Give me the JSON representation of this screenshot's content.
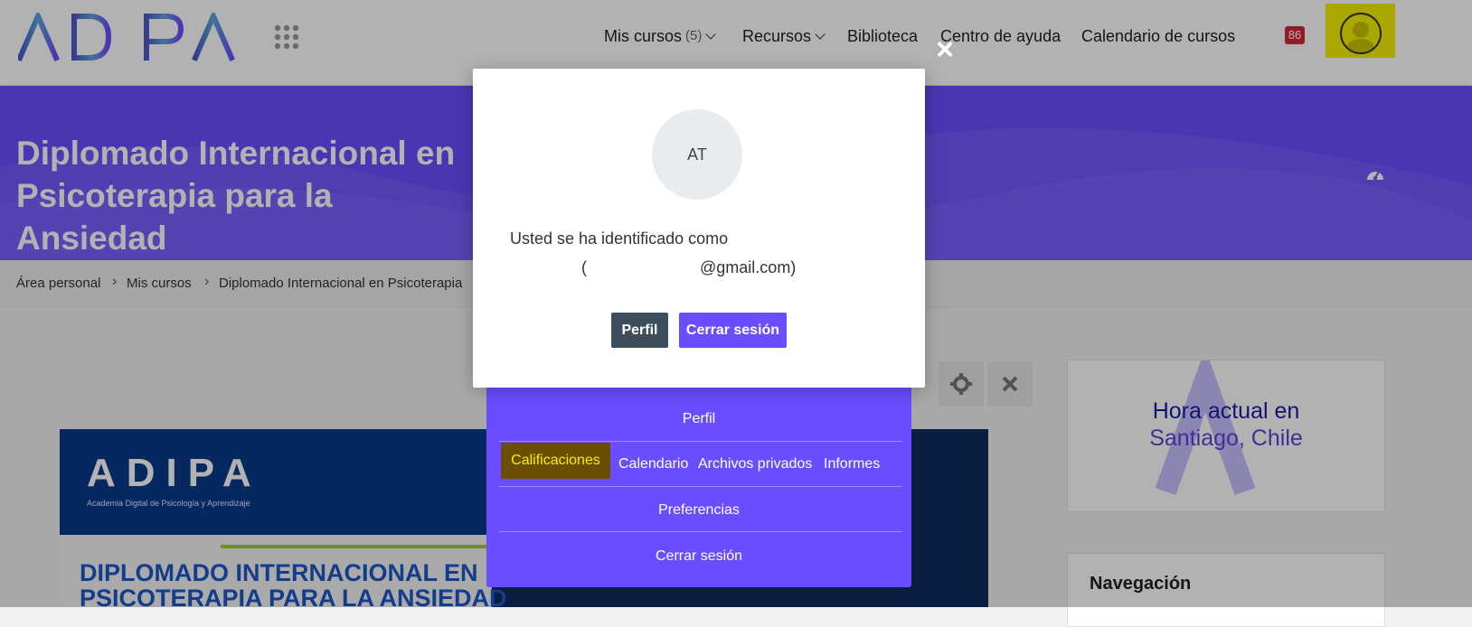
{
  "header": {
    "logo_text": "ADIPA",
    "nav": {
      "mis_cursos": "Mis cursos",
      "mis_cursos_count": "(5)",
      "recursos": "Recursos",
      "biblioteca": "Biblioteca",
      "centro_ayuda": "Centro de ayuda",
      "calendario_cursos": "Calendario de cursos"
    },
    "notification_count": "86"
  },
  "banner": {
    "title": "Diplomado Internacional en Psicoterapia para la Ansiedad"
  },
  "breadcrumb": [
    "Área personal",
    "Mis cursos",
    "Diplomado Internacional en Psicoterapia"
  ],
  "course_image": {
    "logo_text": "ADIPA",
    "subtitle": "Academia Digital de Psicología y Aprendizaje",
    "line1": "DIPLOMADO INTERNACIONAL EN",
    "line2": "PSICOTERAPIA PARA LA ANSIEDAD"
  },
  "clock_block": {
    "line1": "Hora actual en",
    "line2": "Santiago, Chile"
  },
  "nav_block": {
    "title": "Navegación"
  },
  "dropdown": {
    "perfil": "Perfil",
    "calificaciones": "Calificaciones",
    "calendario": "Calendario",
    "archivos": "Archivos privados",
    "informes": "Informes",
    "preferencias": "Preferencias",
    "cerrar": "Cerrar sesión"
  },
  "modal": {
    "avatar_initials": "AT",
    "logged_in_as": "Usted se ha identificado como",
    "email": "(                         @gmail.com)",
    "btn_perfil": "Perfil",
    "btn_cerrar": "Cerrar sesión",
    "close_symbol": "×"
  },
  "colors": {
    "brand_purple": "#6a4dff",
    "highlight_yellow": "#f4f000",
    "badge_red": "#d6263b"
  }
}
